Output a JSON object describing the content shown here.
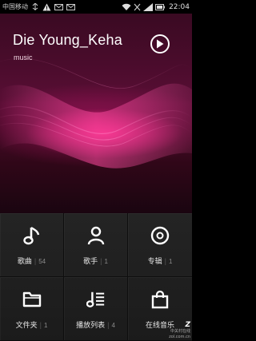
{
  "status_bar": {
    "carrier": "中国移动",
    "time": "22:04"
  },
  "now_playing": {
    "title": "Die Young_Keha",
    "artist": "music"
  },
  "tiles": [
    {
      "label": "歌曲",
      "count": "54",
      "icon": "music-note-icon"
    },
    {
      "label": "歌手",
      "count": "1",
      "icon": "person-icon"
    },
    {
      "label": "专辑",
      "count": "1",
      "icon": "disc-icon"
    },
    {
      "label": "文件夹",
      "count": "1",
      "icon": "folder-icon"
    },
    {
      "label": "播放列表",
      "count": "4",
      "icon": "playlist-icon"
    },
    {
      "label": "在线音乐",
      "count": "",
      "icon": "shopping-bag-icon"
    }
  ],
  "watermark": {
    "brand": "中关村在线",
    "url": "zol.com.cn"
  },
  "colors": {
    "accent": "#e0217a",
    "background": "#1f1f1f"
  }
}
